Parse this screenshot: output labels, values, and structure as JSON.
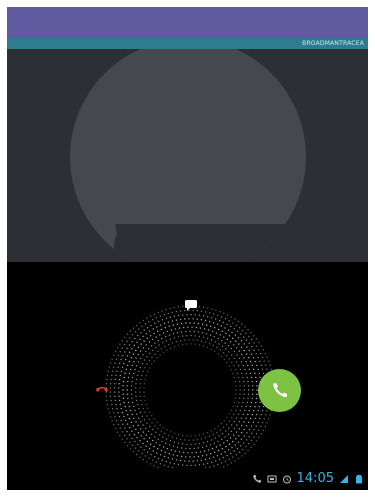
{
  "incoming_call": {
    "caller_id": "BROADMANTRACEA"
  },
  "status_bar": {
    "time": "14:05",
    "icons": [
      "phone-icon",
      "screenshot-icon",
      "alarm-icon",
      "signal-icon",
      "battery-icon"
    ]
  },
  "controls": {
    "message_icon": "message-icon",
    "decline_icon": "decline-call-icon",
    "answer_icon": "answer-call-icon"
  },
  "colors": {
    "top_bar": "#5E5BA0",
    "caller_strip": "#2E7D8E",
    "photo_background": "#2C2F33",
    "avatar": "#45484D",
    "answer_green": "#7DC242",
    "decline_red": "#E53935",
    "clock_blue": "#33B5E5"
  }
}
